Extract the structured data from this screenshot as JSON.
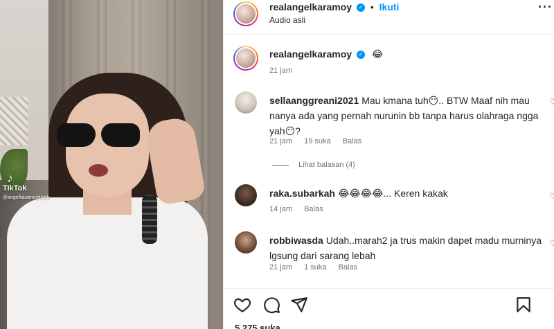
{
  "video": {
    "watermark_brand": "TikTok",
    "watermark_handle": "@angelkaramoytiktok"
  },
  "post": {
    "username": "realangelkaramoy",
    "separator": "•",
    "follow_label": "Ikuti",
    "audio_label": "Audio asli",
    "more_label": "···"
  },
  "caption": {
    "username": "realangelkaramoy",
    "emoji": "😂",
    "time": "21 jam"
  },
  "comments": [
    {
      "username": "sellaanggreani2021",
      "text": "Mau kmana tuh😶.. BTW Maaf nih mau nanya ada yang pernah nurunin bb tanpa harus olahraga ngga yah😶?",
      "time": "21 jam",
      "likes": "19 suka",
      "reply": "Balas",
      "view_replies": "Lihat balasan (4)"
    },
    {
      "username": "raka.subarkah",
      "text": "😂😂😂😂... Keren kakak",
      "time": "14 jam",
      "reply": "Balas"
    },
    {
      "username": "robbiwasda",
      "text": "Udah..marah2 ja trus makin dapet madu murninya lgsung dari sarang lebah",
      "time": "21 jam",
      "likes": "1 suka",
      "reply": "Balas"
    }
  ],
  "likes_count": "5.275 suka",
  "colors": {
    "accent": "#0095f6",
    "secondary_text": "#737373",
    "primary_text": "#262626"
  },
  "icons": [
    "heart-icon",
    "comment-icon",
    "share-icon",
    "bookmark-icon",
    "verified-icon",
    "more-icon"
  ]
}
